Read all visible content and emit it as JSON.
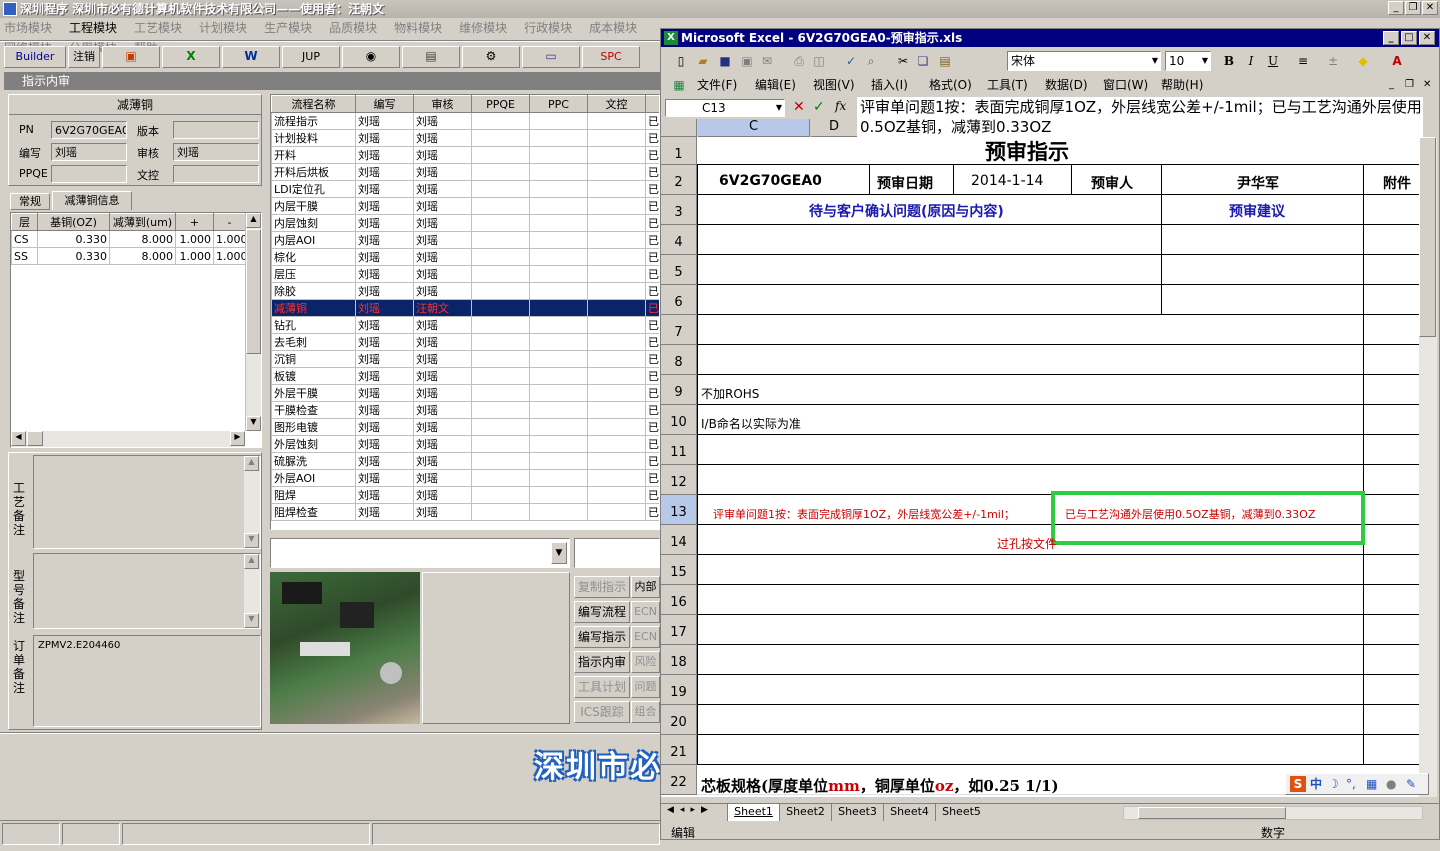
{
  "app": {
    "title": "深圳程序   深圳市必有德计算机软件技术有限公司——使用者：汪朝文",
    "menu": [
      "市场模块",
      "工程模块",
      "工艺模块",
      "计划模块",
      "生产模块",
      "品质模块",
      "物料模块",
      "维修模块",
      "行政模块",
      "成本模块",
      "网络模块",
      "公用模块",
      "帮助"
    ],
    "toolbar": {
      "builder": "Builder",
      "logout": "注销",
      "jup": "JUP",
      "spc": "SPC"
    },
    "subwindow_title": "指示内审"
  },
  "left": {
    "section_title": "减薄铜",
    "pn_label": "PN",
    "pn_value": "6V2G70GEA0",
    "version_label": "版本",
    "version_value": "",
    "author_label": "编写",
    "author_value": "刘瑶",
    "review_label": "审核",
    "review_value": "刘瑶",
    "ppqe_label": "PPQE",
    "ppqe_value": "",
    "wenkong_label": "文控",
    "wenkong_value": "",
    "tabs": [
      "常规",
      "减薄铜信息"
    ],
    "layer_table": {
      "headers": [
        "层",
        "基铜(OZ)",
        "减薄到(um)",
        "+",
        "-"
      ],
      "rows": [
        [
          "CS",
          "0.330",
          "8.000",
          "1.000",
          "1.000"
        ],
        [
          "SS",
          "0.330",
          "8.000",
          "1.000",
          "1.000"
        ]
      ]
    },
    "notes": {
      "process_label": "工艺备注",
      "model_label": "型号备注",
      "order_label": "订单备注",
      "order_value": "ZPMV2.E204460"
    }
  },
  "flow": {
    "headers": [
      "流程名称",
      "编写",
      "审核",
      "PPQE",
      "PPC",
      "文控",
      ""
    ],
    "rows": [
      [
        "流程指示",
        "刘瑶",
        "刘瑶",
        "",
        "",
        "",
        "已"
      ],
      [
        "计划投料",
        "刘瑶",
        "刘瑶",
        "",
        "",
        "",
        "已"
      ],
      [
        "开料",
        "刘瑶",
        "刘瑶",
        "",
        "",
        "",
        "已"
      ],
      [
        "开料后烘板",
        "刘瑶",
        "刘瑶",
        "",
        "",
        "",
        "已"
      ],
      [
        "LDI定位孔",
        "刘瑶",
        "刘瑶",
        "",
        "",
        "",
        "已"
      ],
      [
        "内层干膜",
        "刘瑶",
        "刘瑶",
        "",
        "",
        "",
        "已"
      ],
      [
        "内层蚀刻",
        "刘瑶",
        "刘瑶",
        "",
        "",
        "",
        "已"
      ],
      [
        "内层AOI",
        "刘瑶",
        "刘瑶",
        "",
        "",
        "",
        "已"
      ],
      [
        "棕化",
        "刘瑶",
        "刘瑶",
        "",
        "",
        "",
        "已"
      ],
      [
        "层压",
        "刘瑶",
        "刘瑶",
        "",
        "",
        "",
        "已"
      ],
      [
        "除胶",
        "刘瑶",
        "刘瑶",
        "",
        "",
        "",
        "已"
      ],
      [
        "减薄铜",
        "刘瑶",
        "汪朝文",
        "",
        "",
        "",
        "已"
      ],
      [
        "钻孔",
        "刘瑶",
        "刘瑶",
        "",
        "",
        "",
        "已"
      ],
      [
        "去毛刺",
        "刘瑶",
        "刘瑶",
        "",
        "",
        "",
        "已"
      ],
      [
        "沉铜",
        "刘瑶",
        "刘瑶",
        "",
        "",
        "",
        "已"
      ],
      [
        "板镀",
        "刘瑶",
        "刘瑶",
        "",
        "",
        "",
        "已"
      ],
      [
        "外层干膜",
        "刘瑶",
        "刘瑶",
        "",
        "",
        "",
        "已"
      ],
      [
        "干膜检查",
        "刘瑶",
        "刘瑶",
        "",
        "",
        "",
        "已"
      ],
      [
        "图形电镀",
        "刘瑶",
        "刘瑶",
        "",
        "",
        "",
        "已"
      ],
      [
        "外层蚀刻",
        "刘瑶",
        "刘瑶",
        "",
        "",
        "",
        "已"
      ],
      [
        "硫脲洗",
        "刘瑶",
        "刘瑶",
        "",
        "",
        "",
        "已"
      ],
      [
        "外层AOI",
        "刘瑶",
        "刘瑶",
        "",
        "",
        "",
        "已"
      ],
      [
        "阻焊",
        "刘瑶",
        "刘瑶",
        "",
        "",
        "",
        "已"
      ],
      [
        "阻焊检查",
        "刘瑶",
        "刘瑶",
        "",
        "",
        "",
        "已"
      ]
    ],
    "selected_index": 11
  },
  "actions": {
    "col1": [
      "复制指示",
      "编写流程",
      "编写指示",
      "指示内审",
      "工具计划",
      "ICS跟踪"
    ],
    "col2": [
      "内部",
      "ECN",
      "ECN",
      "风险",
      "问题",
      "组合"
    ]
  },
  "banner": "深圳市必",
  "excel": {
    "title": "Microsoft Excel - 6V2G70GEA0-预审指示.xls",
    "font_name": "宋体",
    "font_size": "10",
    "menu": [
      "文件(F)",
      "编辑(E)",
      "视图(V)",
      "插入(I)",
      "格式(O)",
      "工具(T)",
      "数据(D)",
      "窗口(W)",
      "帮助(H)"
    ],
    "name_box": "C13",
    "formula": "评审单问题1按：表面完成铜厚1OZ，外层线宽公差+/-1mil；已与工艺沟通外层使用0.5OZ基铜，减薄到0.33OZ",
    "col_headers": [
      "C",
      "D"
    ],
    "row_numbers": [
      "1",
      "2",
      "3",
      "4",
      "5",
      "6",
      "7",
      "8",
      "9",
      "10",
      "11",
      "12",
      "13",
      "14",
      "15",
      "16",
      "17",
      "18",
      "19",
      "20",
      "21",
      "22"
    ],
    "sheet_title": "预审指示",
    "part_no": "6V2G70GEA0",
    "date_label": "预审日期",
    "date_value": "2014-1-14",
    "reviewer_label": "预审人",
    "reviewer_value": "尹华军",
    "attach_label": "附件",
    "confirm_header": "待与客户确认问题(原因与内容)",
    "suggest_header": "预审建议",
    "row9": "不加ROHS",
    "row10": "I/B命名以实际为准",
    "row13_a": "评审单问题1按：表面完成铜厚1OZ，外层线宽公差+/-1mil；",
    "row13_b": "已与工艺沟通外层使用0.5OZ基铜，减薄到0.33OZ",
    "row14": "过孔按文件",
    "row22_a": "芯板规格(厚度单位",
    "row22_mm": "mm",
    "row22_b": "，铜厚单位",
    "row22_oz": "oz",
    "row22_c": "，如0.25 1/1)",
    "sheets": [
      "Sheet1",
      "Sheet2",
      "Sheet3",
      "Sheet4",
      "Sheet5"
    ],
    "status_left": "编辑",
    "status_right": "数字",
    "ime_label": "中"
  },
  "colors": {
    "selection": "#0a246a",
    "excel_title": "#000080",
    "highlight_box": "#2ecc40",
    "red_text": "#cc0000",
    "blue_text": "#1a1ab0"
  }
}
